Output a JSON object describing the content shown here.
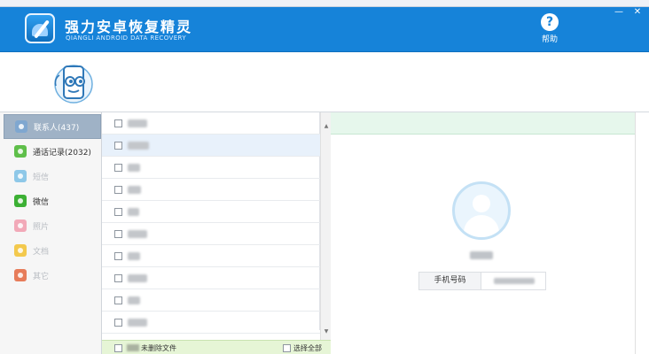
{
  "header": {
    "title": "强力安卓恢复精灵",
    "subtitle": "QIANGLI ANDROID DATA RECOVERY",
    "help_label": "帮助",
    "minimize_symbol": "—",
    "close_symbol": "✕",
    "background_color": "#1683d9"
  },
  "sidebar": {
    "items": [
      {
        "label": "联系人(437)",
        "icon": "contacts-icon",
        "color": "#7fa7d0",
        "state": "active"
      },
      {
        "label": "通话记录(2032)",
        "icon": "phone-call-icon",
        "color": "#5fbf4a",
        "state": "normal"
      },
      {
        "label": "短信",
        "icon": "sms-icon",
        "color": "#8ec8e8",
        "state": "disabled"
      },
      {
        "label": "微信",
        "icon": "wechat-icon",
        "color": "#3cb034",
        "state": "normal"
      },
      {
        "label": "照片",
        "icon": "photo-icon",
        "color": "#f2a9b8",
        "state": "disabled"
      },
      {
        "label": "文档",
        "icon": "document-icon",
        "color": "#f3c94d",
        "state": "disabled"
      },
      {
        "label": "其它",
        "icon": "other-icon",
        "color": "#e77c5a",
        "state": "disabled"
      }
    ]
  },
  "bottom_bar": {
    "undeleted_label": "未删除文件",
    "select_all_label": "选择全部"
  },
  "scrollbar": {
    "up_arrow": "▲",
    "down_arrow": "▼"
  },
  "detail": {
    "phone_label": "手机号码"
  },
  "colors": {
    "accent": "#1683d9",
    "sidebar_active": "#9fb2c6",
    "bottom_bar": "#e6f5d6",
    "detail_header": "#e6f7ec"
  }
}
